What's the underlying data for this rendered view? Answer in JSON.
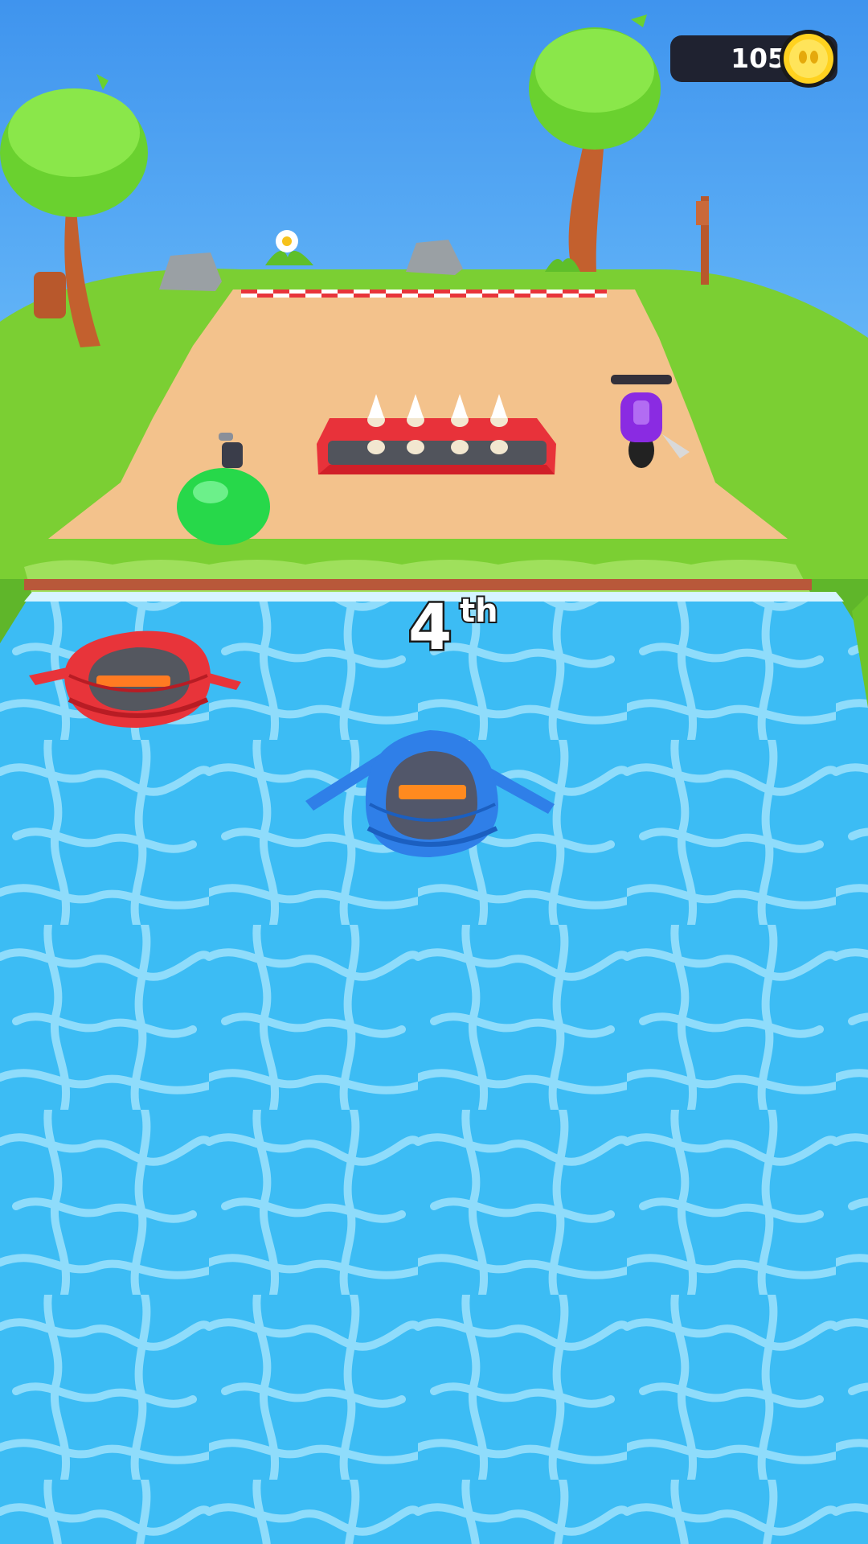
{
  "hud": {
    "coins": "105",
    "coin_icon": "coin-icon"
  },
  "race": {
    "position_number": "4",
    "position_suffix": "th"
  },
  "colors": {
    "sky": "#4a9cf0",
    "grass": "#7ccf35",
    "dirt_track": "#f2c088",
    "water": "#3fbef5",
    "player_raft": "#2f7fe8",
    "rival_raft": "#e8343a",
    "rival_motorbike": "#8a2be2",
    "rival_blob": "#27d84a",
    "coin": "#ffd21f"
  },
  "scene_objects": [
    "tree-left-icon",
    "tree-right-icon",
    "rock-icon",
    "flower-icon",
    "signpost-icon",
    "finish-line",
    "spike-trap-icon",
    "green-blob-racer",
    "purple-motorbike-racer",
    "red-raft-racer",
    "blue-raft-player"
  ]
}
